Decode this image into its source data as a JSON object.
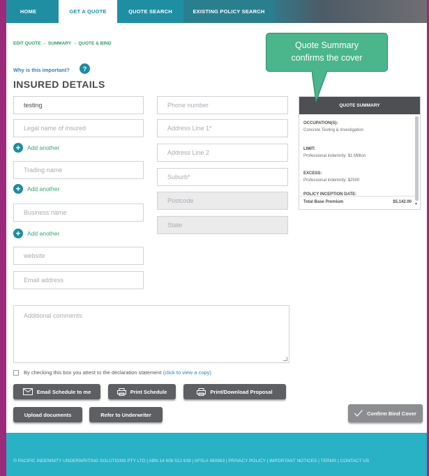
{
  "nav": {
    "tabs": [
      {
        "label": "HOME"
      },
      {
        "label": "GET A QUOTE"
      },
      {
        "label": "QUOTE SEARCH"
      },
      {
        "label": "EXISTING POLICY SEARCH"
      }
    ]
  },
  "breadcrumb": {
    "steps": [
      "EDIT QUOTE",
      "SUMMARY",
      "QUOTE & BIND"
    ],
    "separator": "→"
  },
  "insured": {
    "why_link": "Why is this important?",
    "help_badge": "?",
    "title": "INSURED DETAILS"
  },
  "fields": {
    "left": {
      "name_value": "testing",
      "legal_name": "Legal name of insured",
      "trading_name": "Trading name",
      "business_name": "Business name",
      "website": "website",
      "email": "Email address"
    },
    "right": {
      "phone": "Phone number",
      "address1": "Address Line 1*",
      "address2": "Address Line 2",
      "suburb": "Suburb*",
      "postcode": "Postcode",
      "state": "State"
    },
    "add_another": "Add another",
    "comments": "Additional comments"
  },
  "summary": {
    "header": "QUOTE SUMMARY",
    "occupation_label": "OCCUPATION(S):",
    "occupation_value": "Concrete Testing & Investigation",
    "limit_label": "LIMIT:",
    "limit_value": "Professional indemnity: $1 Million",
    "excess_label": "EXCESS:",
    "excess_value": "Professional indemnity: $2500",
    "inception_label": "POLICY INCEPTION DATE:",
    "premium_label": "Total Base Premium",
    "premium_value": "$5,142.00"
  },
  "callout": {
    "line1": "Quote Summary",
    "line2": "confirms the cover"
  },
  "declaration": {
    "text": "By checking this box you attest to the declaration statement",
    "link": "(click to view a copy)",
    "checked": false
  },
  "buttons": {
    "email_schedule": "Email Schedule to me",
    "print_schedule": "Print Schedule",
    "print_proposal": "Print/Download Proposal",
    "upload_docs": "Upload documents",
    "refer": "Refer to Underwriter",
    "confirm_bind": "Confirm Bind Cover"
  },
  "footer": {
    "text": "© PACIFIC INDEMNITY UNDERWRITING SOLUTIONS PTY LTD | ABN 14 606 512 639 | AFSL# 480863 | PRIVACY POLICY | IMPORTANT NOTICES | TERMS | CONTACT US"
  },
  "colors": {
    "teal": "#1c8da1",
    "green": "#2fa96c",
    "button_dark": "#5d5f63",
    "footer": "#29b1c6",
    "callout": "#4bb58c",
    "page_border": "#9b2b7a"
  }
}
